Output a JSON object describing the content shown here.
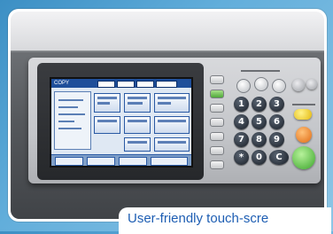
{
  "photo": {
    "caption": "User-friendly touch-scre",
    "screen_header_label": "COPY"
  },
  "keypad": {
    "keys": [
      "1",
      "2",
      "3",
      "4",
      "5",
      "6",
      "7",
      "8",
      "9",
      "*",
      "0",
      "C"
    ]
  },
  "colors": {
    "background_blue": "#4a9bd0",
    "caption_blue": "#1e5eb3",
    "screen_header": "#1f4f9a",
    "start_button": "#3aa52a",
    "stop_button": "#e06a12",
    "energy_button": "#e3b90f"
  }
}
